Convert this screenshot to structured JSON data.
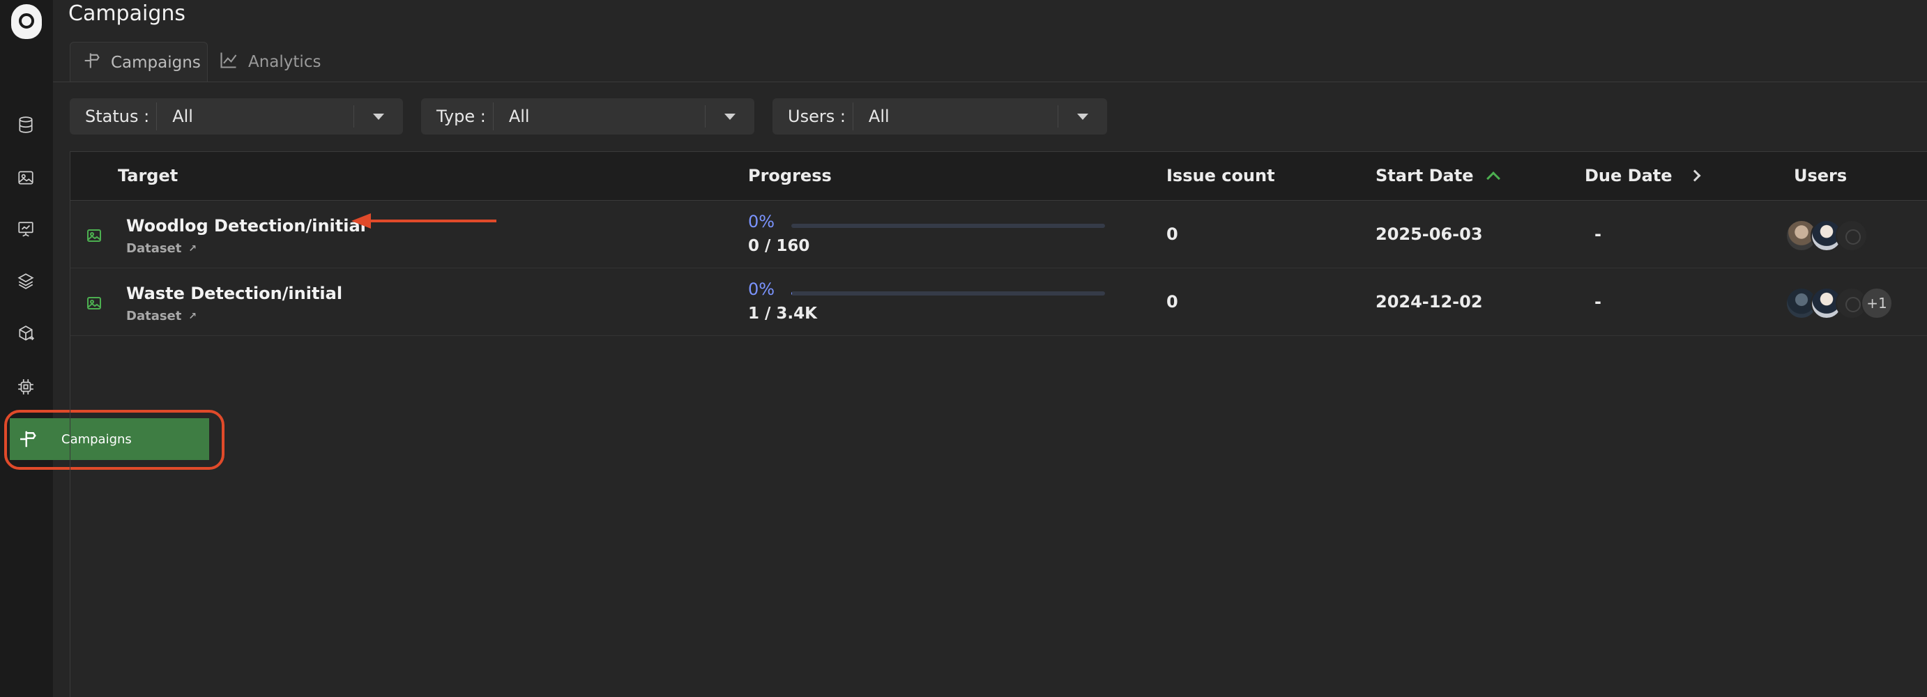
{
  "page": {
    "title": "Campaigns"
  },
  "sidebar": {
    "items": [
      {
        "icon": "database-icon"
      },
      {
        "icon": "image-icon"
      },
      {
        "icon": "presentation-icon"
      },
      {
        "icon": "layers-icon"
      },
      {
        "icon": "box-arrow-icon"
      },
      {
        "icon": "chip-icon"
      }
    ],
    "active_pill": {
      "label": "Campaigns",
      "icon": "signpost-icon"
    }
  },
  "tabs": [
    {
      "label": "Campaigns",
      "icon": "signpost-icon",
      "active": true
    },
    {
      "label": "Analytics",
      "icon": "chart-line-icon",
      "active": false
    }
  ],
  "filters": {
    "status": {
      "label": "Status :",
      "value": "All"
    },
    "type": {
      "label": "Type :",
      "value": "All"
    },
    "users": {
      "label": "Users :",
      "value": "All"
    }
  },
  "table": {
    "headers": {
      "target": "Target",
      "progress": "Progress",
      "issue_count": "Issue count",
      "start_date": "Start Date",
      "due_date": "Due Date",
      "users": "Users"
    },
    "rows": [
      {
        "name": "Woodlog Detection/initial",
        "sub": "Dataset",
        "percent": "0%",
        "progress_fraction": 0,
        "ratio": "0 / 160",
        "issue_count": "0",
        "start_date": "2025-06-03",
        "due_date": "-",
        "avatar_more": ""
      },
      {
        "name": "Waste Detection/initial",
        "sub": "Dataset",
        "percent": "0%",
        "progress_fraction": 0.0003,
        "ratio": "1 / 3.4K",
        "issue_count": "0",
        "start_date": "2024-12-02",
        "due_date": "-",
        "avatar_more": "+1"
      }
    ]
  },
  "colors": {
    "accent_green": "#3e7d43",
    "progress_blue": "#7b94ff",
    "annotation_red": "#e04a2a"
  }
}
